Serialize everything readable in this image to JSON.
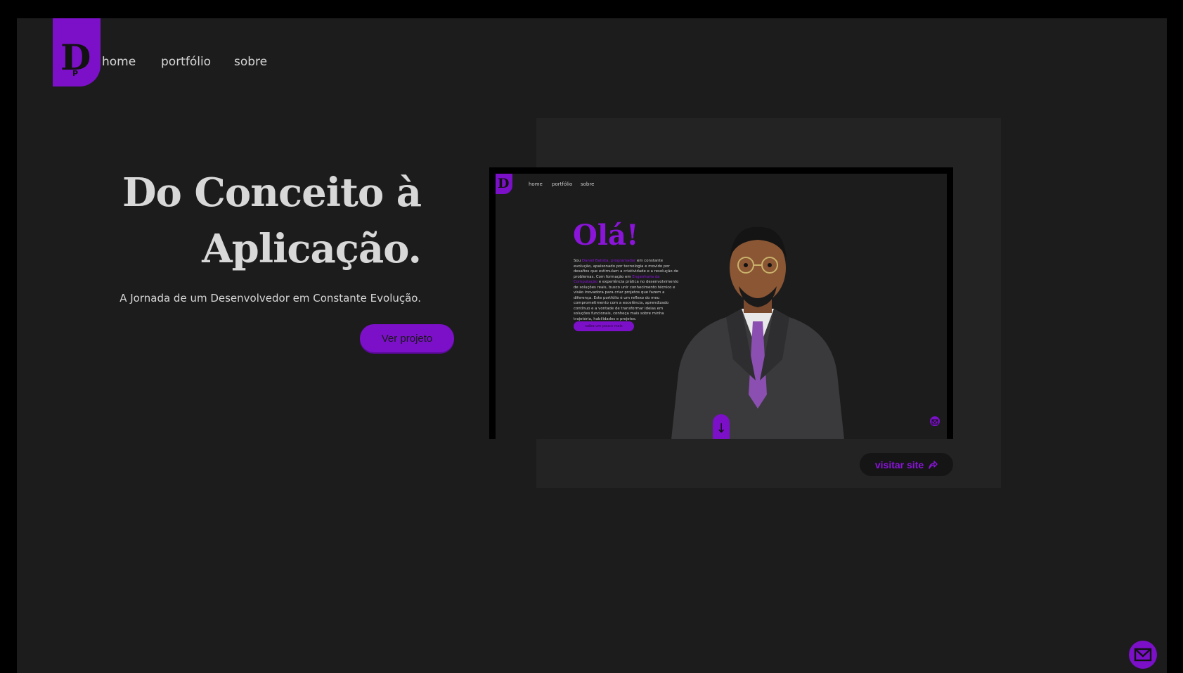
{
  "brand": {
    "logo_letter": "D",
    "logo_small": "P",
    "accent": "#7b10c8",
    "accent_text": "#8a14d8"
  },
  "nav": {
    "items": [
      "home",
      "portfólio",
      "sobre"
    ]
  },
  "hero": {
    "title_line1": "Do Conceito à",
    "title_line2": "Aplicação.",
    "subtitle": "A Jornada de um Desenvolvedor em Constante Evolução.",
    "cta_label": "Ver projeto"
  },
  "preview": {
    "nav": [
      "home",
      "portfólio",
      "sobre"
    ],
    "title": "Olá!",
    "intro_prefix": "Sou",
    "intro_name": "Daniel Batista, programador",
    "intro_rest": "em constante evolução, apaixonado por tecnologia e movido por desafios que estimulam a criatividade e a resolução de problemas.",
    "formation_prefix": "Com formação em",
    "formation_course": "Engenharia da Computação",
    "formation_rest": "e experiência prática no desenvolvimento de soluções reais, busco unir conhecimento técnico e visão inovadora para criar projetos que fazem a diferença. Este portfólio é um reflexo do meu comprometimento com a excelência, aprendizado contínuo e a vontade de transformar ideias em soluções funcionais, conheça mais sobre minha trajetória, habilidades e projetos.",
    "button_label": "saiba um pouco mais",
    "scroll_icon": "arrow-down-icon",
    "mail_icon": "envelope-icon"
  },
  "visit": {
    "label": "visitar site",
    "icon": "share-arrow-icon"
  },
  "fab": {
    "icon": "envelope-icon"
  }
}
